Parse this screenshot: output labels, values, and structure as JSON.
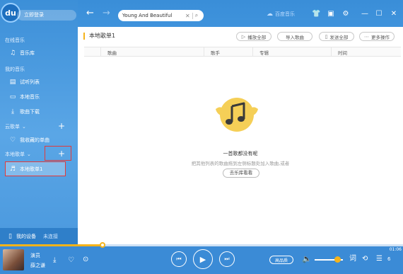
{
  "app": {
    "logo_text": "du",
    "login_label": "立即登录"
  },
  "sidebar": {
    "sections": [
      {
        "label": "在线音乐",
        "items": [
          {
            "label": "音乐库",
            "icon": "music-note-icon"
          }
        ]
      },
      {
        "label": "我的音乐",
        "items": [
          {
            "label": "试听列表",
            "icon": "trial-list-icon"
          },
          {
            "label": "本地音乐",
            "icon": "computer-icon"
          },
          {
            "label": "歌曲下载",
            "icon": "download-icon"
          }
        ]
      }
    ],
    "cloud": {
      "label": "云歌单",
      "items": [
        {
          "label": "我收藏的单曲",
          "icon": "heart-icon"
        }
      ]
    },
    "local": {
      "label": "本地歌单",
      "items": [
        {
          "label": "本地歌单1",
          "icon": "playlist-icon",
          "selected": true
        }
      ]
    },
    "device": {
      "label": "我的设备",
      "status": "未连接"
    }
  },
  "topbar": {
    "search_value": "Young And Beautiful",
    "brand": "百度音乐",
    "icons": [
      "back-arrow-icon",
      "forward-arrow-icon",
      "clear-icon",
      "search-icon",
      "baidu-music-icon",
      "skin-icon",
      "message-icon",
      "settings-icon",
      "minimize-icon",
      "maximize-icon",
      "close-icon"
    ]
  },
  "main": {
    "playlist_title": "本地歌单1",
    "actions": {
      "play_all": "播放全部",
      "import": "导入歌曲",
      "send": "发送全部",
      "more": "更多操作"
    },
    "columns": [
      "歌曲",
      "歌手",
      "专辑",
      "时间"
    ],
    "empty": {
      "title": "一首歌都没有呢",
      "description": "把其他列表的歌曲拖到左侧标题处加入歌曲,或者",
      "button": "去乐库看看"
    }
  },
  "player": {
    "title": "演员",
    "artist": "薛之谦",
    "time": "01:06",
    "quality": "高品质",
    "lyrics_label": "词",
    "playlist_count": "6",
    "progress": 0.255,
    "volume": 0.7,
    "accent": "#f5b31a",
    "theme": "#3b8bd6"
  }
}
